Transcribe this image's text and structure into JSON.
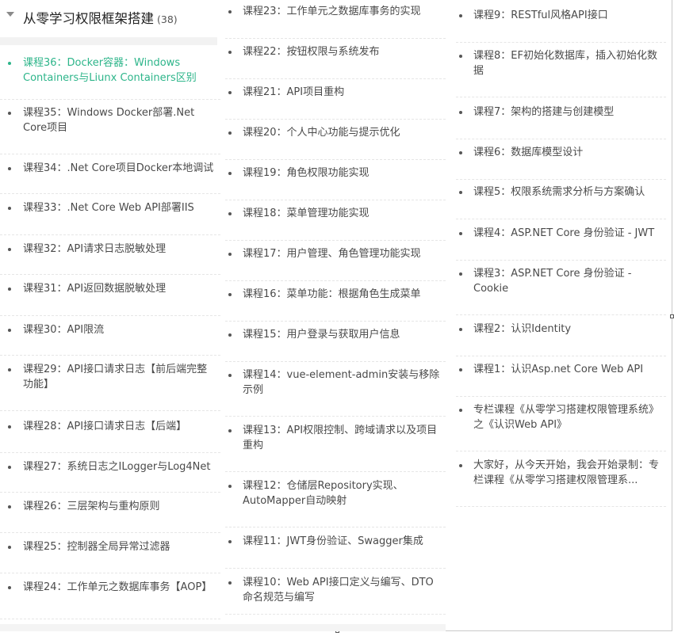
{
  "category": {
    "title": "从零学习权限框架搭建",
    "count": "(38)"
  },
  "column1": [
    {
      "text": "课程36：Docker容器：Windows Containers与Liunx Containers区别",
      "active": true
    },
    {
      "text": "课程35：Windows Docker部署.Net Core项目"
    },
    {
      "text": "课程34：.Net Core项目Docker本地调试"
    },
    {
      "text": "课程33：.Net Core Web API部署IIS"
    },
    {
      "text": "课程32：API请求日志脱敏处理"
    },
    {
      "text": "课程31：API返回数据脱敏处理"
    },
    {
      "text": "课程30：API限流"
    },
    {
      "text": "课程29：API接口请求日志【前后端完整功能】"
    },
    {
      "text": "课程28：API接口请求日志【后端】"
    },
    {
      "text": "课程27：系统日志之ILogger与Log4Net"
    },
    {
      "text": "课程26：三层架构与重构原则"
    },
    {
      "text": "课程25：控制器全局异常过滤器"
    },
    {
      "text": "课程24：工作单元之数据库事务【AOP】"
    }
  ],
  "column2": [
    {
      "text": "课程23：工作单元之数据库事务的实现"
    },
    {
      "text": "课程22：按钮权限与系统发布"
    },
    {
      "text": "课程21：API项目重构"
    },
    {
      "text": "课程20：个人中心功能与提示优化"
    },
    {
      "text": "课程19：角色权限功能实现"
    },
    {
      "text": "课程18：菜单管理功能实现"
    },
    {
      "text": "课程17：用户管理、角色管理功能实现"
    },
    {
      "text": "课程16：菜单功能：根据角色生成菜单"
    },
    {
      "text": "课程15：用户登录与获取用户信息"
    },
    {
      "text": "课程14：vue-element-admin安装与移除示例"
    },
    {
      "text": "课程13：API权限控制、跨域请求以及项目重构"
    },
    {
      "text": "课程12：仓储层Repository实现、AutoMapper自动映射"
    },
    {
      "text": "课程11：JWT身份验证、Swagger集成"
    },
    {
      "text": "课程10：Web API接口定义与编写、DTO命名规范与编写"
    }
  ],
  "column3": [
    {
      "text": "课程9：RESTful风格API接口"
    },
    {
      "text": "课程8：EF初始化数据库，插入初始化数据"
    },
    {
      "text": "课程7：架构的搭建与创建模型"
    },
    {
      "text": "课程6：数据库模型设计"
    },
    {
      "text": "课程5：权限系统需求分析与方案确认"
    },
    {
      "text": "课程4：ASP.NET Core 身份验证 - JWT"
    },
    {
      "text": "课程3：ASP.NET Core 身份验证 - Cookie"
    },
    {
      "text": "课程2：认识Identity"
    },
    {
      "text": "课程1：认识Asp.net Core Web API"
    },
    {
      "text": "专栏课程《从零学习搭建权限管理系统》之《认识Web API》"
    },
    {
      "text": "大家好，从今天开始，我会开始录制：专栏课程《从零学习搭建权限管理系..."
    }
  ],
  "colors": {
    "active": "#2db58a",
    "text": "#4a4a4a"
  }
}
